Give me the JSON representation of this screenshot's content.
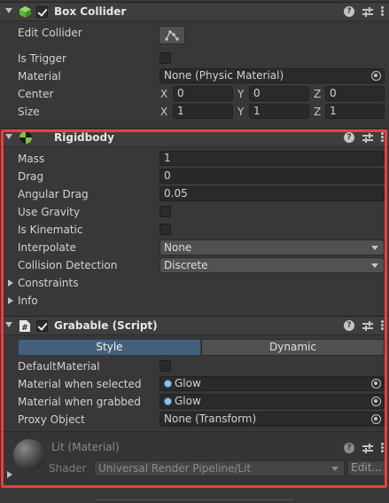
{
  "box_collider": {
    "title": "Box Collider",
    "enabled": true,
    "edit_collider_label": "Edit Collider",
    "is_trigger_label": "Is Trigger",
    "is_trigger": false,
    "material_label": "Material",
    "material_value": "None (Physic Material)",
    "center_label": "Center",
    "center": {
      "x": "0",
      "y": "0",
      "z": "0"
    },
    "size_label": "Size",
    "size": {
      "x": "1",
      "y": "1",
      "z": "1"
    },
    "axis_x": "X",
    "axis_y": "Y",
    "axis_z": "Z"
  },
  "rigidbody": {
    "title": "Rigidbody",
    "mass_label": "Mass",
    "mass": "1",
    "drag_label": "Drag",
    "drag": "0",
    "angular_drag_label": "Angular Drag",
    "angular_drag": "0.05",
    "use_gravity_label": "Use Gravity",
    "use_gravity": false,
    "is_kinematic_label": "Is Kinematic",
    "is_kinematic": false,
    "interpolate_label": "Interpolate",
    "interpolate": "None",
    "collision_detection_label": "Collision Detection",
    "collision_detection": "Discrete",
    "constraints_label": "Constraints",
    "info_label": "Info"
  },
  "grabable": {
    "title": "Grabable (Script)",
    "enabled": true,
    "tab_style": "Style",
    "tab_dynamic": "Dynamic",
    "default_material_label": "DefaultMaterial",
    "default_material": false,
    "mat_selected_label": "Material when selected",
    "mat_selected": "Glow",
    "mat_grabbed_label": "Material when grabbed",
    "mat_grabbed": "Glow",
    "proxy_label": "Proxy Object",
    "proxy": "None (Transform)"
  },
  "material": {
    "title": "Lit (Material)",
    "shader_label": "Shader",
    "shader_value": "Universal Render Pipeline/Lit",
    "edit_label": "Edit..."
  },
  "colors": {
    "highlight": "#f23c3c",
    "tab_selected": "#46607c",
    "background": "#383838"
  }
}
